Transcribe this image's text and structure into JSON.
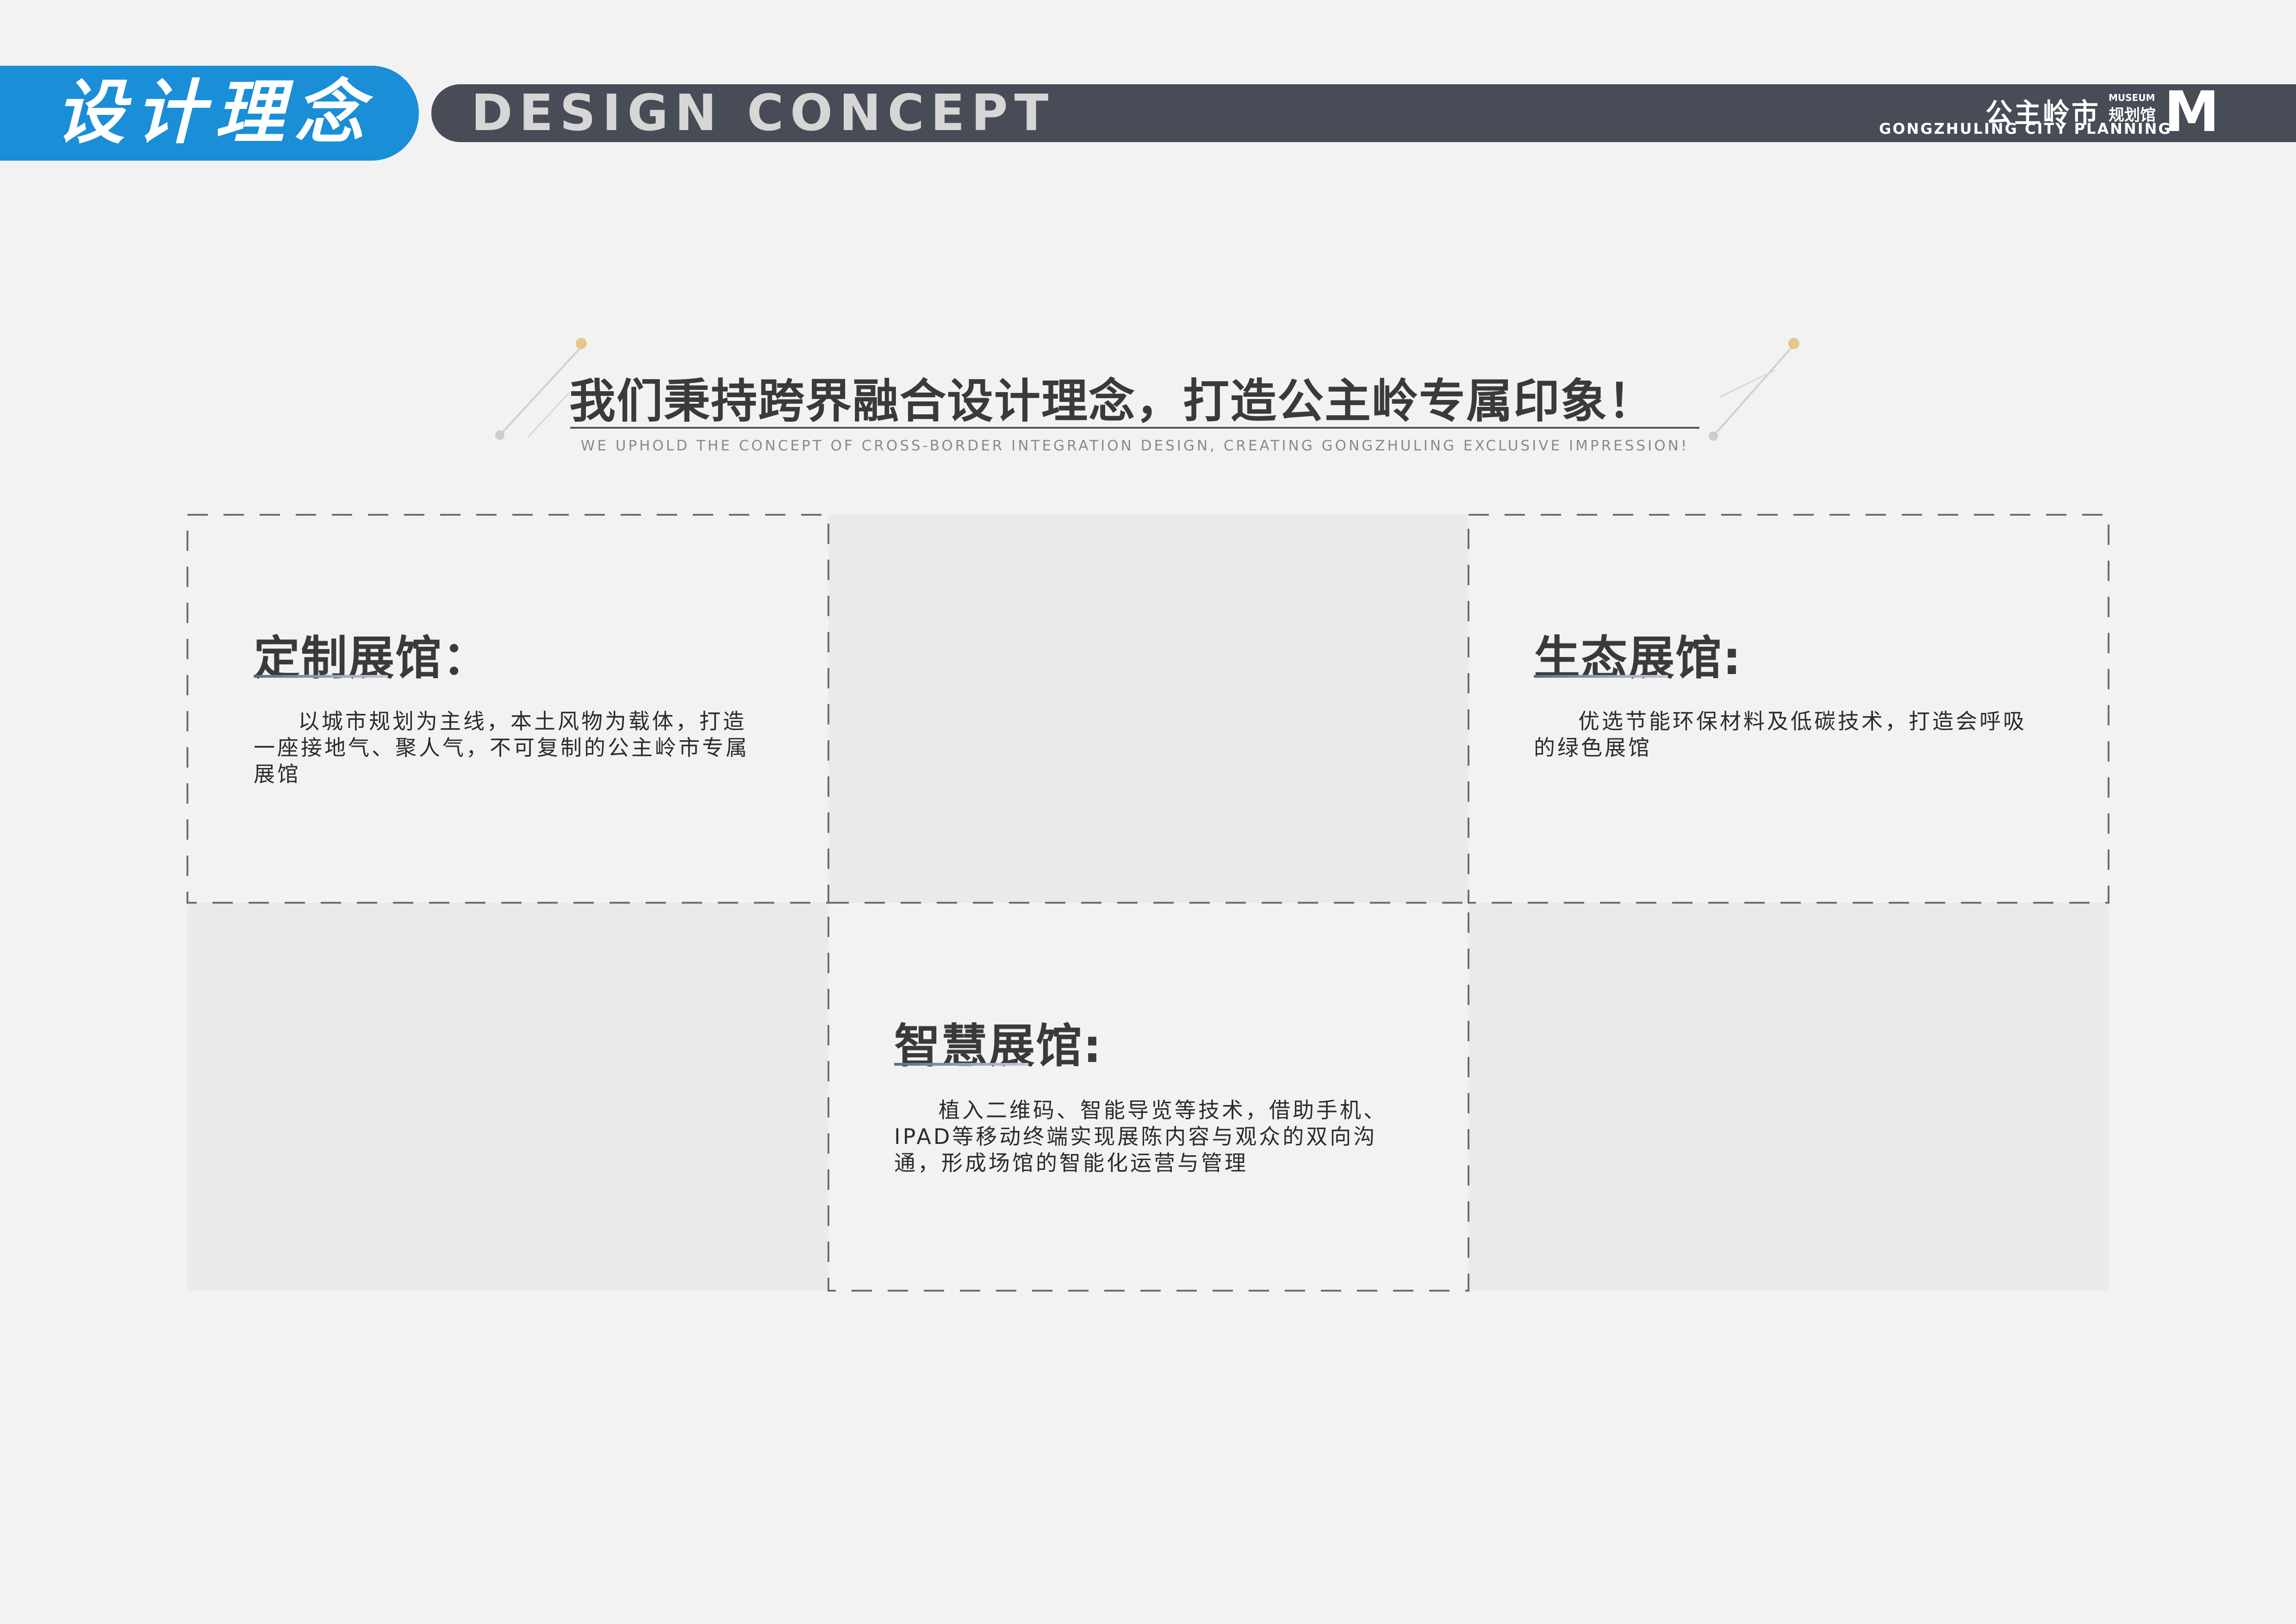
{
  "header": {
    "title_cn": "设计理念",
    "title_en": "DESIGN CONCEPT",
    "logo": {
      "name_cn": "公主岭市",
      "museum_en": "MUSEUM",
      "museum_cn": "规划馆",
      "name_en": "GONGZHULING CITY PLANNING",
      "letter": "M"
    }
  },
  "slogan": {
    "cn": "我们秉持跨界融合设计理念，打造公主岭专属印象！",
    "en": "WE UPHOLD THE CONCEPT OF CROSS-BORDER INTEGRATION DESIGN, CREATING GONGZHULING EXCLUSIVE IMPRESSION!"
  },
  "panels": [
    {
      "title": "定制展馆：",
      "text": "以城市规划为主线，本土风物为载体，打造一座接地气、聚人气，不可复制的公主岭市专属展馆"
    },
    {
      "title": "生态展馆:",
      "text": "优选节能环保材料及低碳技术，打造会呼吸的绿色展馆"
    },
    {
      "title": "智慧展馆:",
      "text": "植入二维码、智能导览等技术，借助手机、IPAD等移动终端实现展陈内容与观众的双向沟通，形成场馆的智能化运营与管理"
    }
  ],
  "colors": {
    "accent_blue": "#1a8ed6",
    "header_dark": "#474c56",
    "background": "#f2f2f2",
    "placeholder_grey": "#eaeaea",
    "deco_gold": "#e8c58a"
  }
}
